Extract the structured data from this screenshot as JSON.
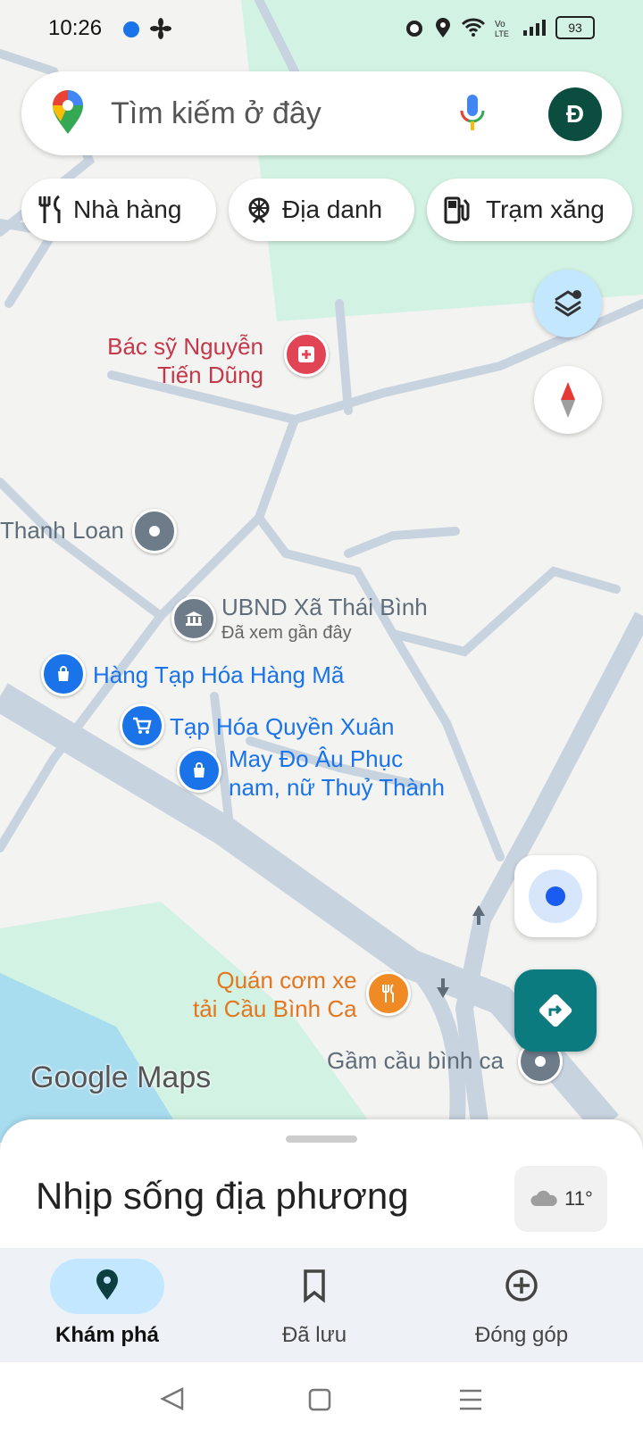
{
  "status_bar": {
    "time": "10:26",
    "battery": "93"
  },
  "search": {
    "placeholder": "Tìm kiếm ở đây",
    "avatar_letter": "Đ"
  },
  "chips": [
    {
      "label": "Nhà hàng",
      "icon": "fork-knife-icon"
    },
    {
      "label": "Địa danh",
      "icon": "landmark-icon"
    },
    {
      "label": "Trạm xăng",
      "icon": "gas-station-icon"
    }
  ],
  "map": {
    "pois": [
      {
        "line1": "Bác sỹ Nguyễn",
        "line2": "Tiến Dũng",
        "color": "#c5374a"
      },
      {
        "line1": "Thanh Loan",
        "color": "#5f6d7a"
      },
      {
        "line1": "UBND Xã Thái Bình",
        "sub": "Đã xem gần đây",
        "color": "#5f6d7a"
      },
      {
        "line1": "Hàng Tạp Hóa Hàng Mã",
        "color": "#1a73e8"
      },
      {
        "line1": "Tạp Hóa Quyền Xuân",
        "color": "#1a73e8"
      },
      {
        "line1": "May Đo Âu Phục",
        "line2": "nam, nữ Thuỷ Thành",
        "color": "#1a73e8"
      },
      {
        "line1": "Quán cơm xe",
        "line2": "tải Cầu Bình Ca",
        "color": "#e3761f"
      },
      {
        "line1": "Gầm cầu bình ca",
        "color": "#5f6d7a"
      }
    ],
    "watermark": "Google Maps"
  },
  "sheet": {
    "title": "Nhịp sống địa phương",
    "temperature": "11°"
  },
  "nav": [
    {
      "label": "Khám phá",
      "icon": "explore-pin-icon",
      "active": true
    },
    {
      "label": "Đã lưu",
      "icon": "bookmark-icon",
      "active": false
    },
    {
      "label": "Đóng góp",
      "icon": "add-circle-icon",
      "active": false
    }
  ],
  "colors": {
    "accent_teal": "#0b7b80",
    "nav_active": "#c2e7ff",
    "avatar": "#0b4d3e"
  }
}
